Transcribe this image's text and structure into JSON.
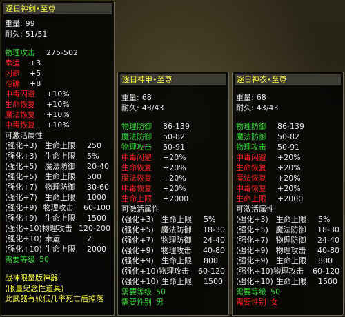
{
  "panel1": {
    "title": "逐日神剑•至尊",
    "weight_label": "重量:",
    "weight": "99",
    "durability_label": "耐久:",
    "durability": "51/51",
    "stats": [
      {
        "label": "物理攻击",
        "value": "275-502",
        "color": "g"
      },
      {
        "label": "幸运",
        "value": "+3",
        "color": "r"
      },
      {
        "label": "闪避",
        "value": "+5",
        "color": "r"
      },
      {
        "label": "准确",
        "value": "+8",
        "color": "r"
      }
    ],
    "extras": [
      {
        "label": "中毒闪避",
        "value": "+10%"
      },
      {
        "label": "生命恢复",
        "value": "+10%"
      },
      {
        "label": "魔法恢复",
        "value": "+10%"
      },
      {
        "label": "中毒恢复",
        "value": "+10%"
      }
    ],
    "activatable_title": "可激活属性",
    "enhancements": [
      {
        "level": "(强化+3)",
        "name": "生命上限",
        "value": "250"
      },
      {
        "level": "(强化+3)",
        "name": "生命上限",
        "value": "5%"
      },
      {
        "level": "(强化+5)",
        "name": "魔法防御",
        "value": "20-40"
      },
      {
        "level": "(强化+5)",
        "name": "生命上限",
        "value": "500"
      },
      {
        "level": "(强化+7)",
        "name": "物理防御",
        "value": "30-60"
      },
      {
        "level": "(强化+7)",
        "name": "生命上限",
        "value": "1000"
      },
      {
        "level": "(强化+9)",
        "name": "物理攻击",
        "value": "60-100"
      },
      {
        "level": "(强化+9)",
        "name": "生命上限",
        "value": "1500"
      },
      {
        "level": "(强化+10)",
        "name": "物理攻击",
        "value": "120-200"
      },
      {
        "level": "(强化+10)",
        "name": "幸运",
        "value": "2"
      },
      {
        "level": "(强化+10)",
        "name": "生命上限",
        "value": "2000"
      }
    ],
    "req_level_label": "需要等级",
    "req_level": "50",
    "footer": [
      "战神限量版神器",
      "(限量纪念性道具)",
      "此武器有较低几率死亡后掉落"
    ]
  },
  "panel2": {
    "title": "逐日神甲•至尊",
    "weight_label": "重量:",
    "weight": "68",
    "durability_label": "耐久:",
    "durability": "43/43",
    "stats": [
      {
        "label": "物理防御",
        "value": "86-139"
      },
      {
        "label": "魔法防御",
        "value": "50-82"
      },
      {
        "label": "物理攻击",
        "value": "50-91"
      }
    ],
    "extras": [
      {
        "label": "中毒闪避",
        "value": "+20%"
      },
      {
        "label": "生命恢复",
        "value": "+20%"
      },
      {
        "label": "魔法恢复",
        "value": "+20%"
      },
      {
        "label": "中毒恢复",
        "value": "+20%"
      },
      {
        "label": "生命上限",
        "value": "+2000"
      }
    ],
    "activatable_title": "可激活属性",
    "enhancements": [
      {
        "level": "(强化+3)",
        "name": "生命上限",
        "value": "5%"
      },
      {
        "level": "(强化+5)",
        "name": "魔法防御",
        "value": "18-30"
      },
      {
        "level": "(强化+7)",
        "name": "物理防御",
        "value": "24-40"
      },
      {
        "level": "(强化+9)",
        "name": "物理攻击",
        "value": "40-80"
      },
      {
        "level": "(强化+9)",
        "name": "生命上限",
        "value": "800"
      },
      {
        "level": "(强化+10)",
        "name": "物理攻击",
        "value": "60-120"
      },
      {
        "level": "(强化+10)",
        "name": "生命上限",
        "value": "1500"
      }
    ],
    "req_level_label": "需要等级",
    "req_level": "50",
    "req_gender_label": "需要性别",
    "req_gender": "男"
  },
  "panel3": {
    "title": "逐日神衣•至尊",
    "weight_label": "重量:",
    "weight": "68",
    "durability_label": "耐久:",
    "durability": "43/43",
    "stats": [
      {
        "label": "物理防御",
        "value": "86-139"
      },
      {
        "label": "魔法防御",
        "value": "50-82"
      },
      {
        "label": "物理攻击",
        "value": "50-91"
      }
    ],
    "extras": [
      {
        "label": "中毒闪避",
        "value": "+20%"
      },
      {
        "label": "生命恢复",
        "value": "+20%"
      },
      {
        "label": "魔法恢复",
        "value": "+20%"
      },
      {
        "label": "中毒恢复",
        "value": "+20%"
      },
      {
        "label": "生命上限",
        "value": "+2000"
      }
    ],
    "activatable_title": "可激活属性",
    "enhancements": [
      {
        "level": "(强化+3)",
        "name": "生命上限",
        "value": "5%"
      },
      {
        "level": "(强化+5)",
        "name": "魔法防御",
        "value": "18-30"
      },
      {
        "level": "(强化+7)",
        "name": "物理防御",
        "value": "24-40"
      },
      {
        "level": "(强化+9)",
        "name": "物理攻击",
        "value": "40-80"
      },
      {
        "level": "(强化+9)",
        "name": "生命上限",
        "value": "800"
      },
      {
        "level": "(强化+10)",
        "name": "物理攻击",
        "value": "60-120"
      },
      {
        "level": "(强化+10)",
        "name": "生命上限",
        "value": "1500"
      }
    ],
    "req_level_label": "需要等级",
    "req_level": "50",
    "req_gender_label": "需要性别",
    "req_gender": "女"
  }
}
